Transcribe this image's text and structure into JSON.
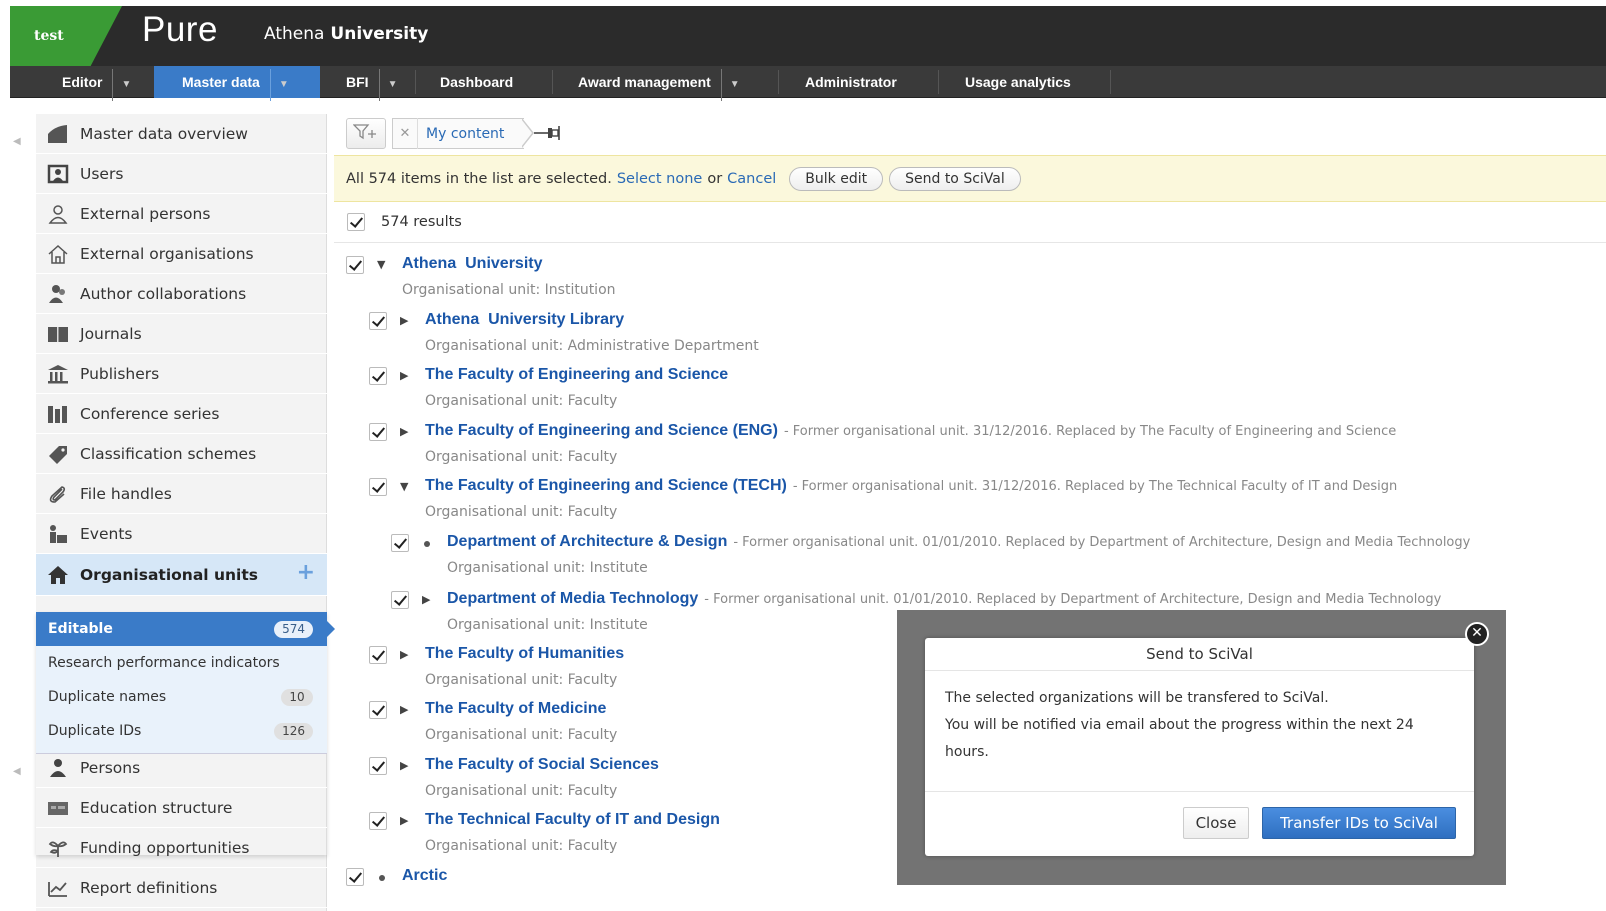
{
  "header": {
    "env": "test",
    "brand": "Pure",
    "institution_first": "Athena",
    "institution_second": "University"
  },
  "nav": {
    "items": [
      {
        "label": "Editor",
        "has_dropdown": true
      },
      {
        "label": "Master data",
        "has_dropdown": true,
        "active": true
      },
      {
        "label": "BFI",
        "has_dropdown": true
      },
      {
        "label": "Dashboard"
      },
      {
        "label": "Award management",
        "has_dropdown": true
      },
      {
        "label": "Administrator"
      },
      {
        "label": "Usage analytics"
      }
    ],
    "dropdown_glyph": "▼"
  },
  "sidebar": {
    "items": [
      {
        "label": "Master data overview",
        "icon": "overview-icon"
      },
      {
        "label": "Users",
        "icon": "users-icon"
      },
      {
        "label": "External persons",
        "icon": "person-outline-icon"
      },
      {
        "label": "External organisations",
        "icon": "house-outline-icon"
      },
      {
        "label": "Author collaborations",
        "icon": "collaboration-icon"
      },
      {
        "label": "Journals",
        "icon": "journal-icon"
      },
      {
        "label": "Publishers",
        "icon": "building-icon"
      },
      {
        "label": "Conference series",
        "icon": "books-icon"
      },
      {
        "label": "Classification schemes",
        "icon": "tag-icon"
      },
      {
        "label": "File handles",
        "icon": "paperclip-icon"
      },
      {
        "label": "Events",
        "icon": "events-icon"
      },
      {
        "label": "Organisational units",
        "icon": "house-icon",
        "active": true
      }
    ],
    "plus": "+",
    "subitems": [
      {
        "label": "Editable",
        "count": "574",
        "active": true
      },
      {
        "label": "Research performance indicators"
      },
      {
        "label": "Duplicate names",
        "count": "10"
      },
      {
        "label": "Duplicate IDs",
        "count": "126"
      }
    ],
    "lower_items": [
      {
        "label": "Persons",
        "icon": "person-icon"
      },
      {
        "label": "Education structure",
        "icon": "education-icon"
      },
      {
        "label": "Funding opportunities",
        "icon": "funding-icon"
      },
      {
        "label": "Report definitions",
        "icon": "report-icon"
      }
    ]
  },
  "filter": {
    "chip_label": "My content",
    "add_filter_icon": "filter-plus-icon",
    "remove_icon": "close-icon",
    "pin_icon": "pin-icon"
  },
  "selection": {
    "text": "All 574 items in the list are selected.",
    "select_none": "Select none",
    "or": "or",
    "cancel": "Cancel",
    "bulk_edit": "Bulk edit",
    "send_scival": "Send to SciVal"
  },
  "results": {
    "count_label": "574 results"
  },
  "tree": [
    {
      "title": "Athena  University",
      "sub": "Organisational unit: Institution",
      "level": 0,
      "toggle": "▼"
    },
    {
      "title": "Athena  University Library",
      "sub": "Organisational unit: Administrative Department",
      "level": 1,
      "toggle": "▶"
    },
    {
      "title": "The Faculty of Engineering and Science",
      "sub": "Organisational unit: Faculty",
      "level": 1,
      "toggle": "▶"
    },
    {
      "title": "The Faculty of Engineering and Science (ENG)",
      "former": "- Former organisational unit. 31/12/2016. Replaced by The Faculty of Engineering and Science",
      "sub": "Organisational unit: Faculty",
      "level": 1,
      "toggle": "▶"
    },
    {
      "title": "The Faculty of Engineering and Science (TECH)",
      "former": "- Former organisational unit. 31/12/2016. Replaced by The Technical Faculty of IT and Design",
      "sub": "Organisational unit: Faculty",
      "level": 1,
      "toggle": "▼"
    },
    {
      "title": "Department of Architecture & Design",
      "former": "- Former organisational unit. 01/01/2010. Replaced by Department of Architecture, Design and Media Technology",
      "sub": "Organisational unit: Institute",
      "level": 2,
      "toggle": "•"
    },
    {
      "title": "Department of Media Technology",
      "former": "- Former organisational unit. 01/01/2010. Replaced by Department of Architecture, Design and Media Technology",
      "sub": "Organisational unit: Institute",
      "level": 2,
      "toggle": "▶"
    },
    {
      "title": "The Faculty of Humanities",
      "sub": "Organisational unit: Faculty",
      "level": 1,
      "toggle": "▶"
    },
    {
      "title": "The Faculty of Medicine",
      "sub": "Organisational unit: Faculty",
      "level": 1,
      "toggle": "▶"
    },
    {
      "title": "The Faculty of Social Sciences",
      "sub": "Organisational unit: Faculty",
      "level": 1,
      "toggle": "▶"
    },
    {
      "title": "The Technical Faculty of IT and Design",
      "sub": "Organisational unit: Faculty",
      "level": 1,
      "toggle": "▶"
    },
    {
      "title": "Arctic",
      "sub": "",
      "level": 0,
      "toggle": "•"
    }
  ],
  "modal": {
    "title": "Send to SciVal",
    "line1": "The selected organizations will be transfered to SciVal.",
    "line2": "You will be notified via email about the progress within the next 24 hours.",
    "close": "Close",
    "transfer": "Transfer IDs to SciVal",
    "close_glyph": "✕"
  },
  "colors": {
    "accent": "#3a7bc8",
    "brand_green": "#3a9b35",
    "link": "#1a56a8",
    "header_bg": "#2b2b2b"
  }
}
